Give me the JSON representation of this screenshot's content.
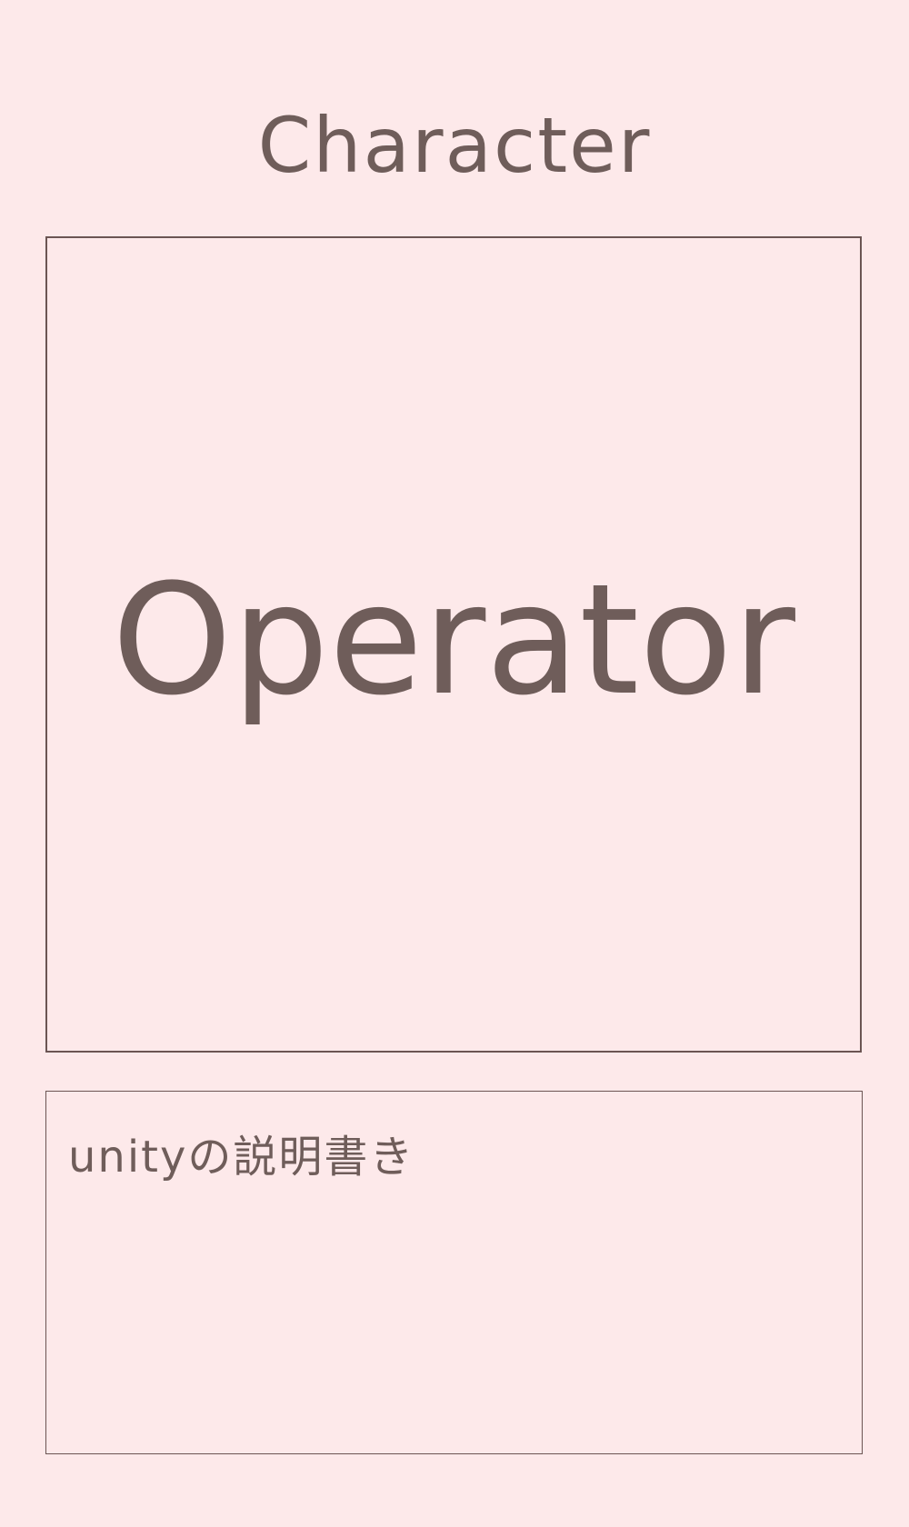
{
  "page": {
    "title": "Character"
  },
  "character": {
    "name": "Operator"
  },
  "description": {
    "text": "unityの説明書き"
  },
  "colors": {
    "background": "#fde9ea",
    "text": "#6f5d5a",
    "border": "#6b5553"
  }
}
